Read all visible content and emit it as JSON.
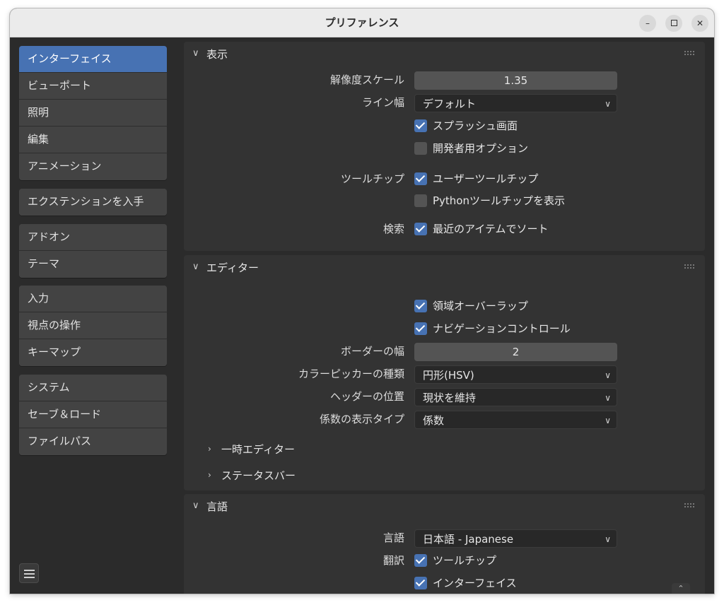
{
  "window": {
    "title": "プリファレンス"
  },
  "sidebar": {
    "groups": [
      [
        "インターフェイス",
        "ビューポート",
        "照明",
        "編集",
        "アニメーション"
      ],
      [
        "エクステンションを入手"
      ],
      [
        "アドオン",
        "テーマ"
      ],
      [
        "入力",
        "視点の操作",
        "キーマップ"
      ],
      [
        "システム",
        "セーブ＆ロード",
        "ファイルパス"
      ]
    ],
    "active": "インターフェイス"
  },
  "display": {
    "title": "表示",
    "resolution_scale_label": "解像度スケール",
    "resolution_scale_value": "1.35",
    "line_width_label": "ライン幅",
    "line_width_value": "デフォルト",
    "splash_label": "スプラッシュ画面",
    "splash_checked": true,
    "dev_options_label": "開発者用オプション",
    "dev_options_checked": false,
    "tooltips_label": "ツールチップ",
    "user_tooltips_label": "ユーザーツールチップ",
    "user_tooltips_checked": true,
    "python_tooltips_label": "Pythonツールチップを表示",
    "python_tooltips_checked": false,
    "search_label": "検索",
    "sort_recent_label": "最近のアイテムでソート",
    "sort_recent_checked": true
  },
  "editors": {
    "title": "エディター",
    "region_overlap_label": "領域オーバーラップ",
    "region_overlap_checked": true,
    "nav_controls_label": "ナビゲーションコントロール",
    "nav_controls_checked": true,
    "border_width_label": "ボーダーの幅",
    "border_width_value": "2",
    "color_picker_label": "カラーピッカーの種類",
    "color_picker_value": "円形(HSV)",
    "header_pos_label": "ヘッダーの位置",
    "header_pos_value": "現状を維持",
    "factor_label": "係数の表示タイプ",
    "factor_value": "係数",
    "temp_editors": "一時エディター",
    "status_bar": "ステータスバー"
  },
  "language": {
    "title": "言語",
    "language_label": "言語",
    "language_value": "日本語 - Japanese",
    "translate_label": "翻訳",
    "tooltips_label": "ツールチップ",
    "tooltips_checked": true,
    "interface_label": "インターフェイス",
    "interface_checked": true
  },
  "colors": {
    "accent": "#4772b3",
    "panel": "#333333",
    "background": "#2b2b2b"
  }
}
